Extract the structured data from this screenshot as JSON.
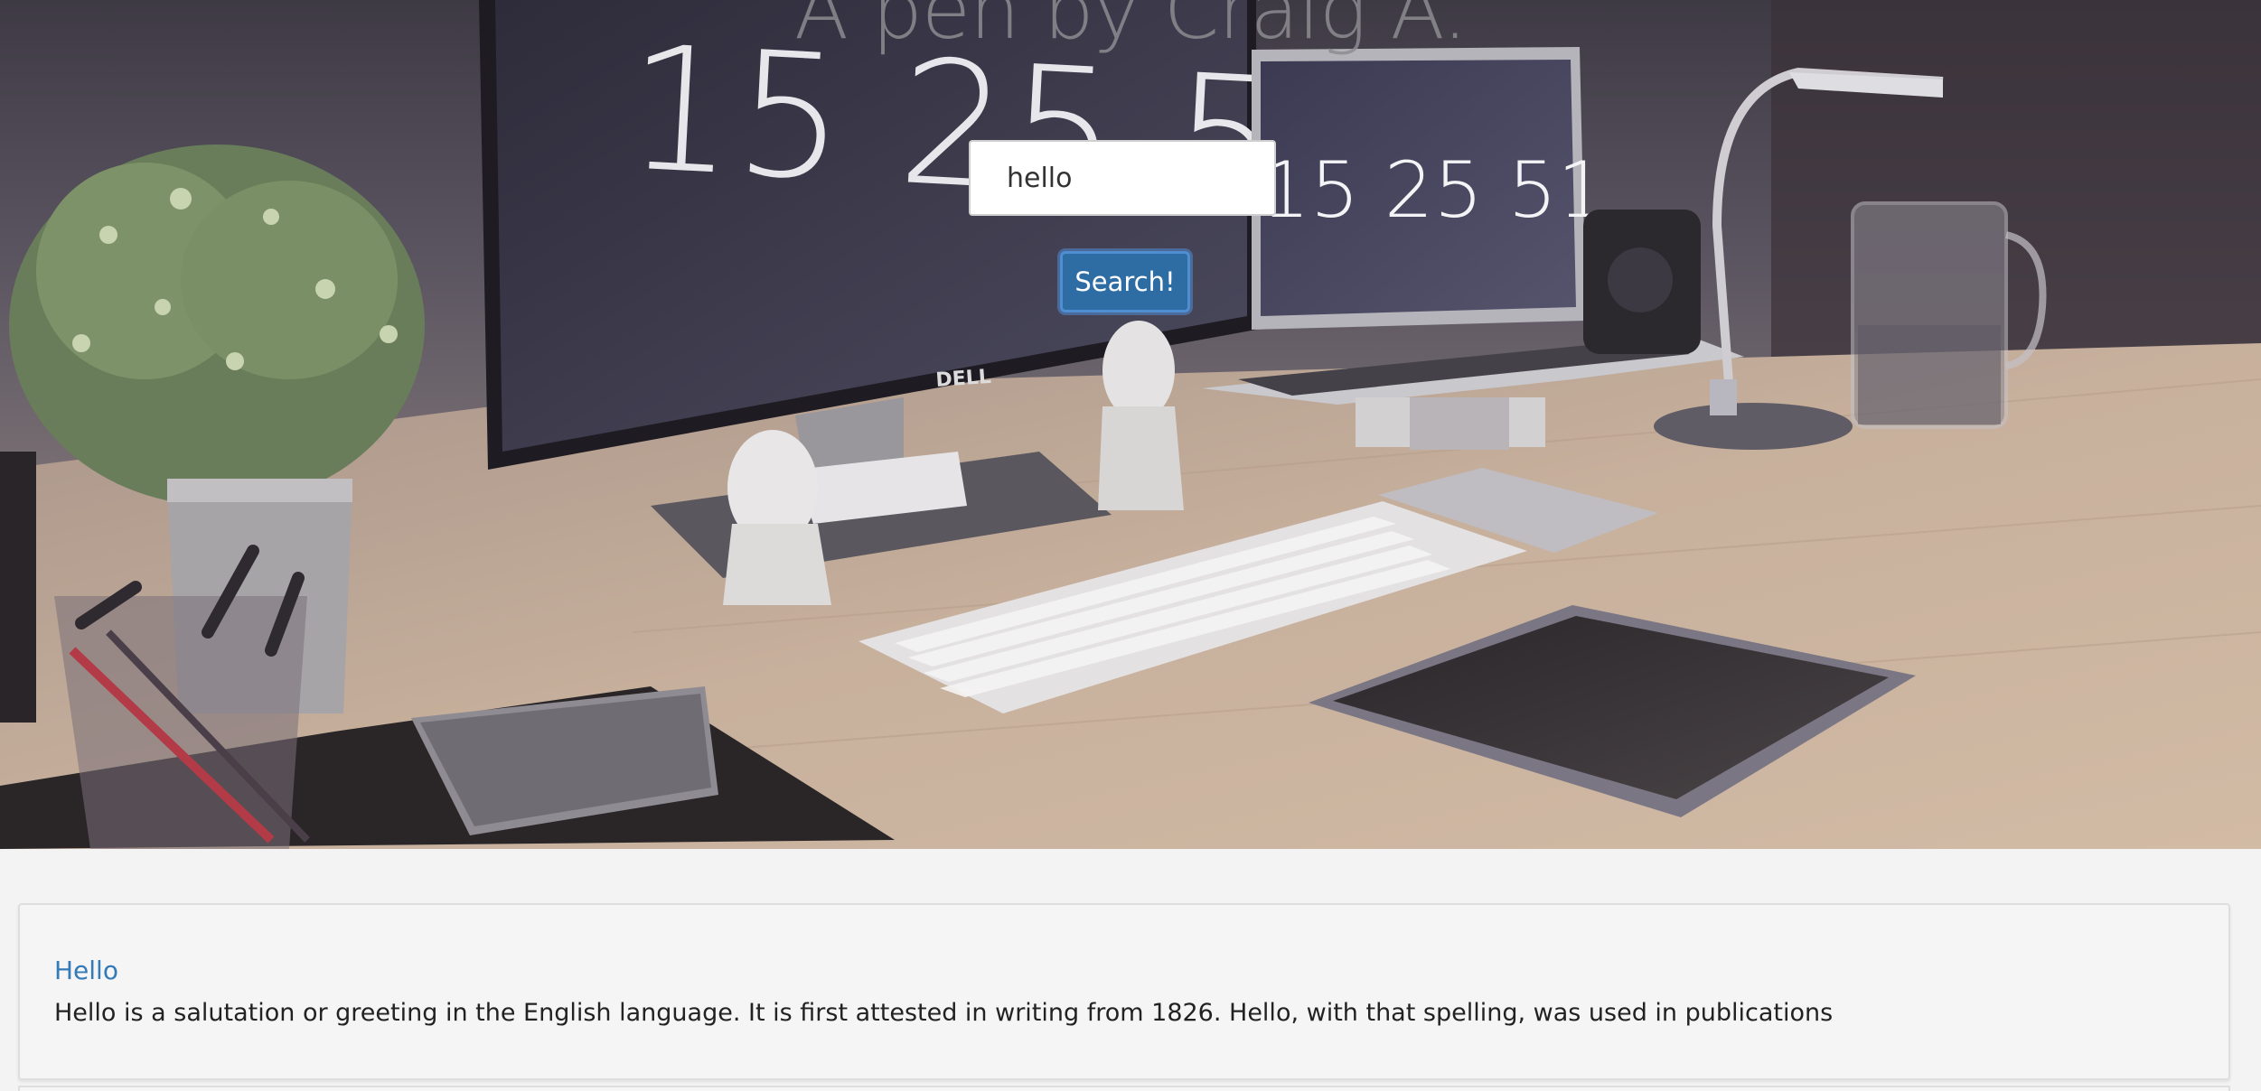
{
  "header": {
    "title": "A pen by Craig A."
  },
  "search": {
    "value": "hello",
    "button_label": "Search!"
  },
  "hero_clock": {
    "monitor_time": "15 25 51",
    "laptop_time": "15 25 51"
  },
  "results": [
    {
      "title": "Hello",
      "snippet": "Hello is a salutation or greeting in the English language. It is first attested in writing from 1826. Hello, with that spelling, was used in publications"
    }
  ],
  "colors": {
    "link": "#337ab7",
    "button": "#2e6da4",
    "page_background": "#f3f3f3"
  }
}
